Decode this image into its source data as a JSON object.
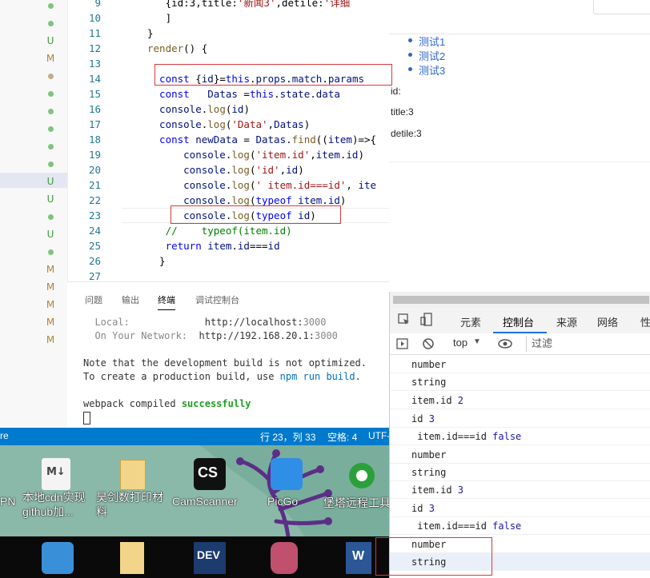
{
  "editor": {
    "lines": [
      {
        "num": "9",
        "html": [
          [
            "ident",
            "   {id:3,title:"
          ],
          [
            "str",
            "'新闻3'"
          ],
          [
            "ident",
            ",detile:"
          ],
          [
            "str",
            "'详细"
          ]
        ]
      },
      {
        "num": "10",
        "html": [
          [
            "ident",
            "   ]"
          ]
        ]
      },
      {
        "num": "11",
        "html": [
          [
            "ident",
            "}"
          ]
        ]
      },
      {
        "num": "12",
        "html": [
          [
            "fn",
            "render"
          ],
          [
            "ident",
            "() {"
          ]
        ]
      },
      {
        "num": "13",
        "html": []
      },
      {
        "num": "14",
        "html": [
          [
            "kw",
            "  const"
          ],
          [
            "ident",
            " {"
          ],
          [
            "var",
            "id"
          ],
          [
            "ident",
            "}="
          ],
          [
            "kw",
            "this"
          ],
          [
            "ident",
            "."
          ],
          [
            "var",
            "props"
          ],
          [
            "ident",
            "."
          ],
          [
            "var",
            "match"
          ],
          [
            "ident",
            "."
          ],
          [
            "var",
            "params"
          ]
        ]
      },
      {
        "num": "15",
        "html": [
          [
            "kw",
            "  const"
          ],
          [
            "ident",
            "   "
          ],
          [
            "var",
            "Datas"
          ],
          [
            "ident",
            " ="
          ],
          [
            "kw",
            "this"
          ],
          [
            "ident",
            "."
          ],
          [
            "var",
            "state"
          ],
          [
            "ident",
            "."
          ],
          [
            "var",
            "data"
          ]
        ]
      },
      {
        "num": "16",
        "html": [
          [
            "var",
            "  console"
          ],
          [
            "ident",
            "."
          ],
          [
            "fn",
            "log"
          ],
          [
            "ident",
            "("
          ],
          [
            "var",
            "id"
          ],
          [
            "ident",
            ")"
          ]
        ]
      },
      {
        "num": "17",
        "html": [
          [
            "var",
            "  console"
          ],
          [
            "ident",
            "."
          ],
          [
            "fn",
            "log"
          ],
          [
            "ident",
            "("
          ],
          [
            "str",
            "'Data'"
          ],
          [
            "ident",
            ","
          ],
          [
            "var",
            "Datas"
          ],
          [
            "ident",
            ")"
          ]
        ]
      },
      {
        "num": "18",
        "html": [
          [
            "kw",
            "  const"
          ],
          [
            "ident",
            " "
          ],
          [
            "var",
            "newData"
          ],
          [
            "ident",
            " = "
          ],
          [
            "var",
            "Datas"
          ],
          [
            "ident",
            "."
          ],
          [
            "fn",
            "find"
          ],
          [
            "ident",
            "(("
          ],
          [
            "var",
            "item"
          ],
          [
            "ident",
            ")=>{"
          ]
        ]
      },
      {
        "num": "19",
        "html": [
          [
            "var",
            "      console"
          ],
          [
            "ident",
            "."
          ],
          [
            "fn",
            "log"
          ],
          [
            "ident",
            "("
          ],
          [
            "str",
            "'item.id'"
          ],
          [
            "ident",
            ","
          ],
          [
            "var",
            "item"
          ],
          [
            "ident",
            "."
          ],
          [
            "var",
            "id"
          ],
          [
            "ident",
            ")"
          ]
        ]
      },
      {
        "num": "20",
        "html": [
          [
            "var",
            "      console"
          ],
          [
            "ident",
            "."
          ],
          [
            "fn",
            "log"
          ],
          [
            "ident",
            "("
          ],
          [
            "str",
            "'id'"
          ],
          [
            "ident",
            ","
          ],
          [
            "var",
            "id"
          ],
          [
            "ident",
            ")"
          ]
        ]
      },
      {
        "num": "21",
        "html": [
          [
            "var",
            "      console"
          ],
          [
            "ident",
            "."
          ],
          [
            "fn",
            "log"
          ],
          [
            "ident",
            "("
          ],
          [
            "str",
            "' item.id===id'"
          ],
          [
            "ident",
            ", "
          ],
          [
            "var",
            "ite"
          ]
        ]
      },
      {
        "num": "22",
        "html": [
          [
            "var",
            "      console"
          ],
          [
            "ident",
            "."
          ],
          [
            "fn",
            "log"
          ],
          [
            "ident",
            "("
          ],
          [
            "kw",
            "typeof"
          ],
          [
            "ident",
            " "
          ],
          [
            "var",
            "item"
          ],
          [
            "ident",
            "."
          ],
          [
            "var",
            "id"
          ],
          [
            "ident",
            ")"
          ]
        ]
      },
      {
        "num": "23",
        "html": [
          [
            "var",
            "      console"
          ],
          [
            "ident",
            "."
          ],
          [
            "fn",
            "log"
          ],
          [
            "ident",
            "("
          ],
          [
            "kw",
            "typeof"
          ],
          [
            "ident",
            " "
          ],
          [
            "var",
            "id"
          ],
          [
            "ident",
            ")"
          ]
        ]
      },
      {
        "num": "24",
        "html": [
          [
            "cmt",
            "   //    typeof(item.id)"
          ]
        ]
      },
      {
        "num": "25",
        "html": [
          [
            "kw",
            "   return"
          ],
          [
            "ident",
            " "
          ],
          [
            "var",
            "item"
          ],
          [
            "ident",
            "."
          ],
          [
            "var",
            "id"
          ],
          [
            "ident",
            "==="
          ],
          [
            "var",
            "id"
          ]
        ]
      },
      {
        "num": "26",
        "html": [
          [
            "ident",
            "  }"
          ]
        ]
      },
      {
        "num": "27",
        "html": []
      }
    ],
    "gutter": [
      "dot",
      "dot",
      "U",
      "M",
      "dot-brown",
      "dot",
      "dot",
      "dot",
      "dot",
      "dot",
      "U",
      "U",
      "dot",
      "U",
      "dot",
      "M",
      "M",
      "M",
      "M",
      "M"
    ]
  },
  "panel": {
    "tabs": [
      "问题",
      "输出",
      "终端",
      "调试控制台"
    ],
    "local_label": "Local:",
    "local_url": "http://localhost:",
    "local_port": "3000",
    "network_label": "On Your Network:",
    "network_url": "http://192.168.20.1:",
    "network_port": "3000",
    "note1": "Note that the development build is not optimized.",
    "note2_a": "To create a production build, use ",
    "note2_b": "npm run build",
    "note2_c": ".",
    "webpack_a": "webpack compiled ",
    "webpack_b": "successfully"
  },
  "status": {
    "left": "re",
    "position": "行 23，列 33",
    "spaces": "空格: 4",
    "encoding": "UTF-"
  },
  "desktop": {
    "icons": [
      {
        "label": "PN"
      },
      {
        "label": "本地cdn实现\ngithub加..."
      },
      {
        "label": "昊剑数打印材\n料"
      },
      {
        "label": "CamScanner"
      },
      {
        "label": "PicGo"
      },
      {
        "label": "堡塔远程工具"
      }
    ]
  },
  "browser": {
    "links": [
      "测试1",
      "测试2",
      "测试3"
    ],
    "id_label": "id:",
    "title_label": "title:3",
    "detile_label": "detile:3"
  },
  "devtools": {
    "tabs": [
      "元素",
      "控制台",
      "来源",
      "网络",
      "性"
    ],
    "context": "top",
    "filter_placeholder": "过滤",
    "console": [
      {
        "text": "number"
      },
      {
        "text": "string"
      },
      {
        "text": "item.id ",
        "num": "2"
      },
      {
        "text": "id ",
        "num": "3"
      },
      {
        "text": " item.id===id ",
        "bool": "false"
      },
      {
        "text": "number"
      },
      {
        "text": "string"
      },
      {
        "text": "item.id ",
        "num": "3"
      },
      {
        "text": "id ",
        "num": "3"
      },
      {
        "text": " item.id===id ",
        "bool": "false"
      },
      {
        "text": "number"
      },
      {
        "text": "string"
      }
    ]
  }
}
